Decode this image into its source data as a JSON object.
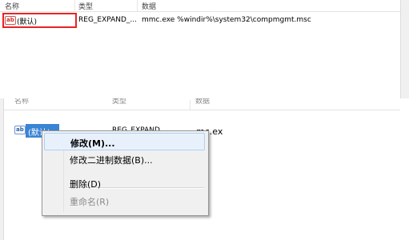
{
  "top_panel": {
    "columns": [
      "名称",
      "类型",
      "数据"
    ],
    "row": {
      "icon": "ab-string-icon",
      "name": "(默认)",
      "type": "REG_EXPAND_...",
      "data": "mmc.exe %windir%\\system32\\compmgmt.msc"
    }
  },
  "bottom_panel": {
    "columns": [
      "名称",
      "类型",
      "数据"
    ],
    "row": {
      "icon": "ab-string-icon",
      "name": "(默认)",
      "type": "REG_EXPAND_",
      "data": "mc.ex"
    }
  },
  "context_menu": {
    "items": [
      {
        "label": "修改(M)...",
        "bold": true,
        "state": "hover"
      },
      {
        "label": "修改二进制数据(B)...",
        "bold": false,
        "state": "normal"
      },
      {
        "label": "删除(D)",
        "bold": false,
        "state": "normal"
      },
      {
        "label": "重命名(R)",
        "bold": false,
        "state": "disabled"
      }
    ]
  },
  "colors": {
    "selection": "#3a84d4",
    "highlight_box": "#e52525",
    "menu_hover": "#e8f1fb"
  }
}
